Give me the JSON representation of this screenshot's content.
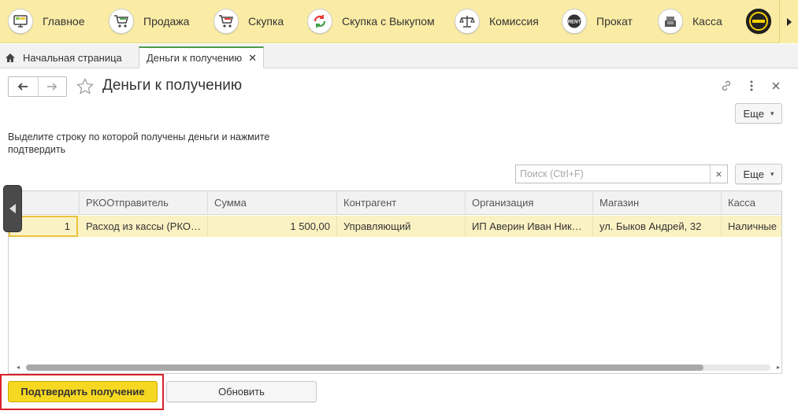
{
  "sections": [
    {
      "label": "Главное",
      "icon": "monitor-icon"
    },
    {
      "label": "Продажа",
      "icon": "cart-icon"
    },
    {
      "label": "Скупка",
      "icon": "cart-icon"
    },
    {
      "label": "Скупка с Выкупом",
      "icon": "refresh-icon"
    },
    {
      "label": "Комиссия",
      "icon": "scales-icon"
    },
    {
      "label": "Прокат",
      "icon": "rent-icon"
    },
    {
      "label": "Касса",
      "icon": "cash-register-icon"
    }
  ],
  "tabs": {
    "home_label": "Начальная страница",
    "active_label": "Деньги к получению"
  },
  "form": {
    "title": "Деньги к получению",
    "more_label": "Еще",
    "instruction": "Выделите строку по которой получены деньги и нажмите подтвердить",
    "search_placeholder": "Поиск (Ctrl+F)",
    "clear_symbol": "×"
  },
  "table": {
    "columns": [
      "",
      "РКООтправитель",
      "Сумма",
      "Контрагент",
      "Организация",
      "Магазин",
      "Касса"
    ],
    "rows": [
      [
        "1",
        "Расход из кассы (РКО…",
        "1 500,00",
        "Управляющий",
        "ИП Аверин Иван Ник…",
        "ул. Быков Андрей, 32",
        "Наличные"
      ]
    ]
  },
  "buttons": {
    "confirm_label": "Подтвердить получение",
    "refresh_label": "Обновить"
  },
  "colors": {
    "section_bar": "#fbeca5",
    "selected_row": "#fbf2c3",
    "confirm_button": "#f6d822",
    "highlight_frame": "#d9222b",
    "active_tab_accent": "#4a9c47"
  }
}
